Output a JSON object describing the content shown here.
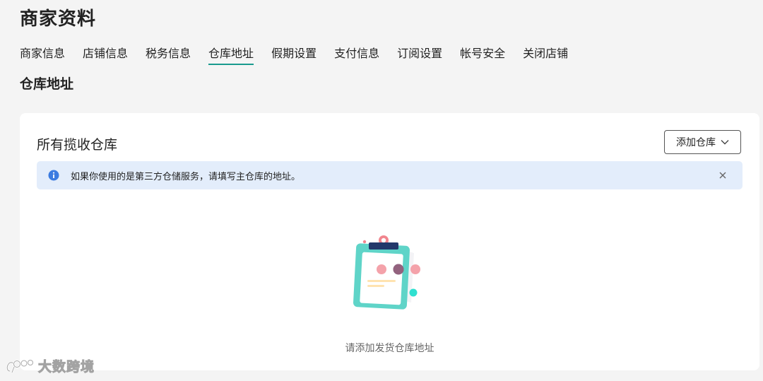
{
  "page": {
    "title": "商家资料"
  },
  "tabs": [
    {
      "label": "商家信息",
      "active": false
    },
    {
      "label": "店铺信息",
      "active": false
    },
    {
      "label": "税务信息",
      "active": false
    },
    {
      "label": "仓库地址",
      "active": true
    },
    {
      "label": "假期设置",
      "active": false
    },
    {
      "label": "支付信息",
      "active": false
    },
    {
      "label": "订阅设置",
      "active": false
    },
    {
      "label": "帐号安全",
      "active": false
    },
    {
      "label": "关闭店铺",
      "active": false
    }
  ],
  "section": {
    "title": "仓库地址"
  },
  "card": {
    "title": "所有揽收仓库",
    "add_button_label": "添加仓库",
    "notice_text": "如果你使用的是第三方仓储服务，请填写主仓库的地址。",
    "empty_text": "请添加发货仓库地址"
  },
  "watermark": {
    "text": "大数跨境"
  },
  "colors": {
    "accent": "#1a9a8e",
    "info": "#3b7be0",
    "notice_bg": "#e3edfb",
    "illustration_teal": "#5fd4c8",
    "illustration_navy": "#23386b",
    "illustration_pink": "#f1858e"
  },
  "icons": {
    "add_button": "chevron-down-icon",
    "notice": "info-icon",
    "notice_close": "close-icon",
    "empty": "clipboard-illustration"
  }
}
